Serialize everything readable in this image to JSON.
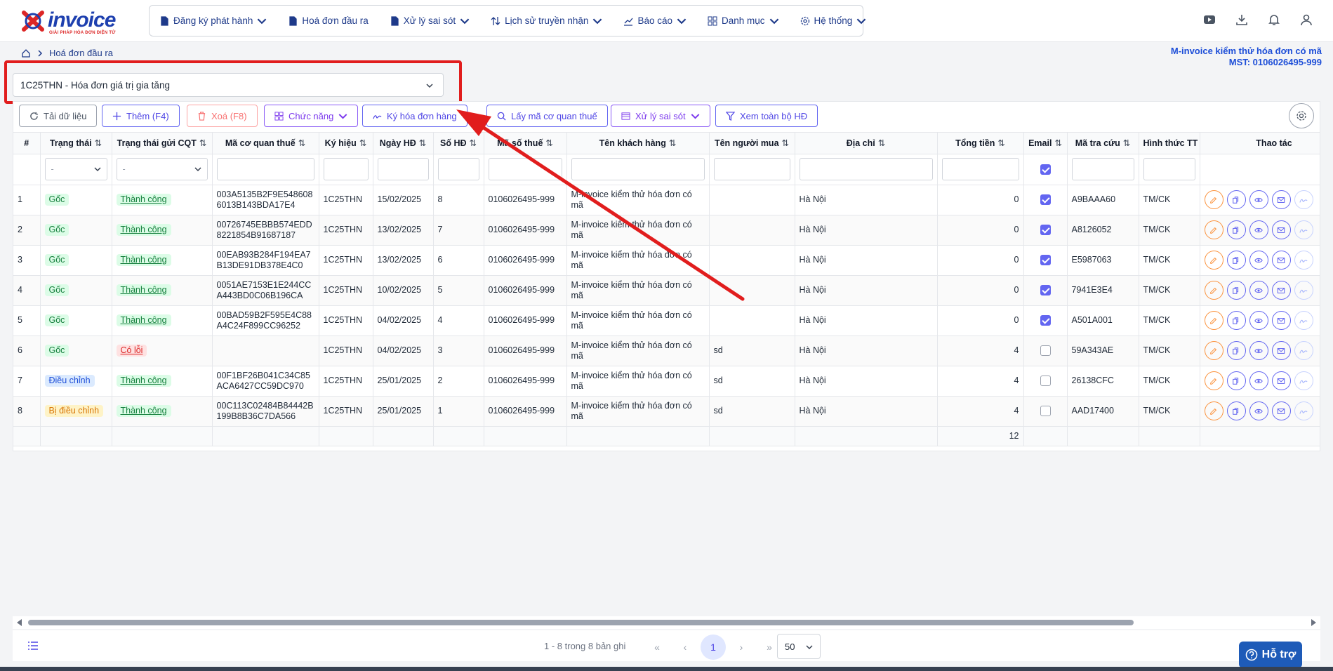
{
  "logo": {
    "name": "invoice",
    "tagline": "GIẢI PHÁP HÓA ĐƠN ĐIỆN TỬ"
  },
  "nav": [
    {
      "label": "Đăng ký phát hành",
      "icon": "file-register-icon",
      "has_dropdown": true
    },
    {
      "label": "Hoá đơn đầu ra",
      "icon": "document-icon",
      "has_dropdown": false
    },
    {
      "label": "Xử lý sai sót",
      "icon": "file-error-icon",
      "has_dropdown": true
    },
    {
      "label": "Lịch sử truyền nhận",
      "icon": "transfer-icon",
      "has_dropdown": true
    },
    {
      "label": "Báo cáo",
      "icon": "chart-icon",
      "has_dropdown": true
    },
    {
      "label": "Danh mục",
      "icon": "grid-icon",
      "has_dropdown": true
    },
    {
      "label": "Hệ thống",
      "icon": "gear-icon",
      "has_dropdown": true
    }
  ],
  "breadcrumb": {
    "page": "Hoá đơn đầu ra"
  },
  "company": {
    "name": "M-invoice kiểm thử hóa đơn có mã",
    "tax_id": "MST: 0106026495-999"
  },
  "series_select": {
    "value": "1C25THN - Hóa đơn giá trị gia tăng"
  },
  "toolbar": {
    "reload": "Tải dữ liệu",
    "add": "Thêm (F4)",
    "delete": "Xoá (F8)",
    "functions": "Chức năng",
    "sign": "Ký hóa đơn hàng",
    "get_code": "Lấy mã cơ quan thuế",
    "error_handling": "Xử lý sai sót",
    "view_all": "Xem toàn bộ HĐ"
  },
  "columns": [
    "#",
    "Trạng thái",
    "Trạng thái gửi CQT",
    "Mã cơ quan thuế",
    "Ký hiệu",
    "Ngày HĐ",
    "Số HĐ",
    "Mã số thuế",
    "Tên khách hàng",
    "Tên người mua",
    "Địa chỉ",
    "Tổng tiền",
    "Email",
    "Mã tra cứu",
    "Hình thức TT",
    "Thao tác"
  ],
  "filters": {
    "status_placeholder": "-",
    "cqt_placeholder": "-"
  },
  "rows": [
    {
      "no": "1",
      "status": "Gốc",
      "status_type": "goc",
      "cqt": "Thành công",
      "cqt_type": "ok",
      "tax_code": "003A5135B2F9E5486086013B143BDA17E4",
      "symbol": "1C25THN",
      "date": "15/02/2025",
      "number": "8",
      "mst": "0106026495-999",
      "customer": "M-invoice kiểm thử hóa đơn có mã",
      "buyer": "",
      "address": "Hà Nội",
      "total": "0",
      "email": true,
      "lookup": "A9BAAA60",
      "payment": "TM/CK"
    },
    {
      "no": "2",
      "status": "Gốc",
      "status_type": "goc",
      "cqt": "Thành công",
      "cqt_type": "ok",
      "tax_code": "00726745EBBB574EDD8221854B91687187",
      "symbol": "1C25THN",
      "date": "13/02/2025",
      "number": "7",
      "mst": "0106026495-999",
      "customer": "M-invoice kiểm thử hóa đơn có mã",
      "buyer": "",
      "address": "Hà Nội",
      "total": "0",
      "email": true,
      "lookup": "A8126052",
      "payment": "TM/CK"
    },
    {
      "no": "3",
      "status": "Gốc",
      "status_type": "goc",
      "cqt": "Thành công",
      "cqt_type": "ok",
      "tax_code": "00EAB93B284F194EA7B13DE91DB378E4C0",
      "symbol": "1C25THN",
      "date": "13/02/2025",
      "number": "6",
      "mst": "0106026495-999",
      "customer": "M-invoice kiểm thử hóa đơn có mã",
      "buyer": "",
      "address": "Hà Nội",
      "total": "0",
      "email": true,
      "lookup": "E5987063",
      "payment": "TM/CK"
    },
    {
      "no": "4",
      "status": "Gốc",
      "status_type": "goc",
      "cqt": "Thành công",
      "cqt_type": "ok",
      "tax_code": "0051AE7153E1E244CCA443BD0C06B196CA",
      "symbol": "1C25THN",
      "date": "10/02/2025",
      "number": "5",
      "mst": "0106026495-999",
      "customer": "M-invoice kiểm thử hóa đơn có mã",
      "buyer": "",
      "address": "Hà Nội",
      "total": "0",
      "email": true,
      "lookup": "7941E3E4",
      "payment": "TM/CK"
    },
    {
      "no": "5",
      "status": "Gốc",
      "status_type": "goc",
      "cqt": "Thành công",
      "cqt_type": "ok",
      "tax_code": "00BAD59B2F595E4C88A4C24F899CC96252",
      "symbol": "1C25THN",
      "date": "04/02/2025",
      "number": "4",
      "mst": "0106026495-999",
      "customer": "M-invoice kiểm thử hóa đơn có mã",
      "buyer": "",
      "address": "Hà Nội",
      "total": "0",
      "email": true,
      "lookup": "A501A001",
      "payment": "TM/CK"
    },
    {
      "no": "6",
      "status": "Gốc",
      "status_type": "goc",
      "cqt": "Có lỗi",
      "cqt_type": "err",
      "tax_code": "",
      "symbol": "1C25THN",
      "date": "04/02/2025",
      "number": "3",
      "mst": "0106026495-999",
      "customer": "M-invoice kiểm thử hóa đơn có mã",
      "buyer": "sd",
      "address": "Hà Nội",
      "total": "4",
      "email": false,
      "lookup": "59A343AE",
      "payment": "TM/CK"
    },
    {
      "no": "7",
      "status": "Điều chỉnh",
      "status_type": "dc",
      "cqt": "Thành công",
      "cqt_type": "ok",
      "tax_code": "00F1BF26B041C34C85ACA6427CC59DC970",
      "symbol": "1C25THN",
      "date": "25/01/2025",
      "number": "2",
      "mst": "0106026495-999",
      "customer": "M-invoice kiểm thử hóa đơn có mã",
      "buyer": "sd",
      "address": "Hà Nội",
      "total": "4",
      "email": false,
      "lookup": "26138CFC",
      "payment": "TM/CK"
    },
    {
      "no": "8",
      "status": "Bị điều chỉnh",
      "status_type": "bdc",
      "cqt": "Thành công",
      "cqt_type": "ok",
      "tax_code": "00C113C02484B84442B199B8B36C7DA566",
      "symbol": "1C25THN",
      "date": "25/01/2025",
      "number": "1",
      "mst": "0106026495-999",
      "customer": "M-invoice kiểm thử hóa đơn có mã",
      "buyer": "sd",
      "address": "Hà Nội",
      "total": "4",
      "email": false,
      "lookup": "AAD17400",
      "payment": "TM/CK"
    }
  ],
  "totals": {
    "total": "12"
  },
  "pagination": {
    "summary": "1 - 8 trong 8 bản ghi",
    "current": "1",
    "per_page": "50"
  },
  "support": {
    "label": "Hỗ trợ"
  },
  "colors": {
    "accent": "#6366f1",
    "annotation": "#e11d1d",
    "brand": "#1e40af"
  }
}
